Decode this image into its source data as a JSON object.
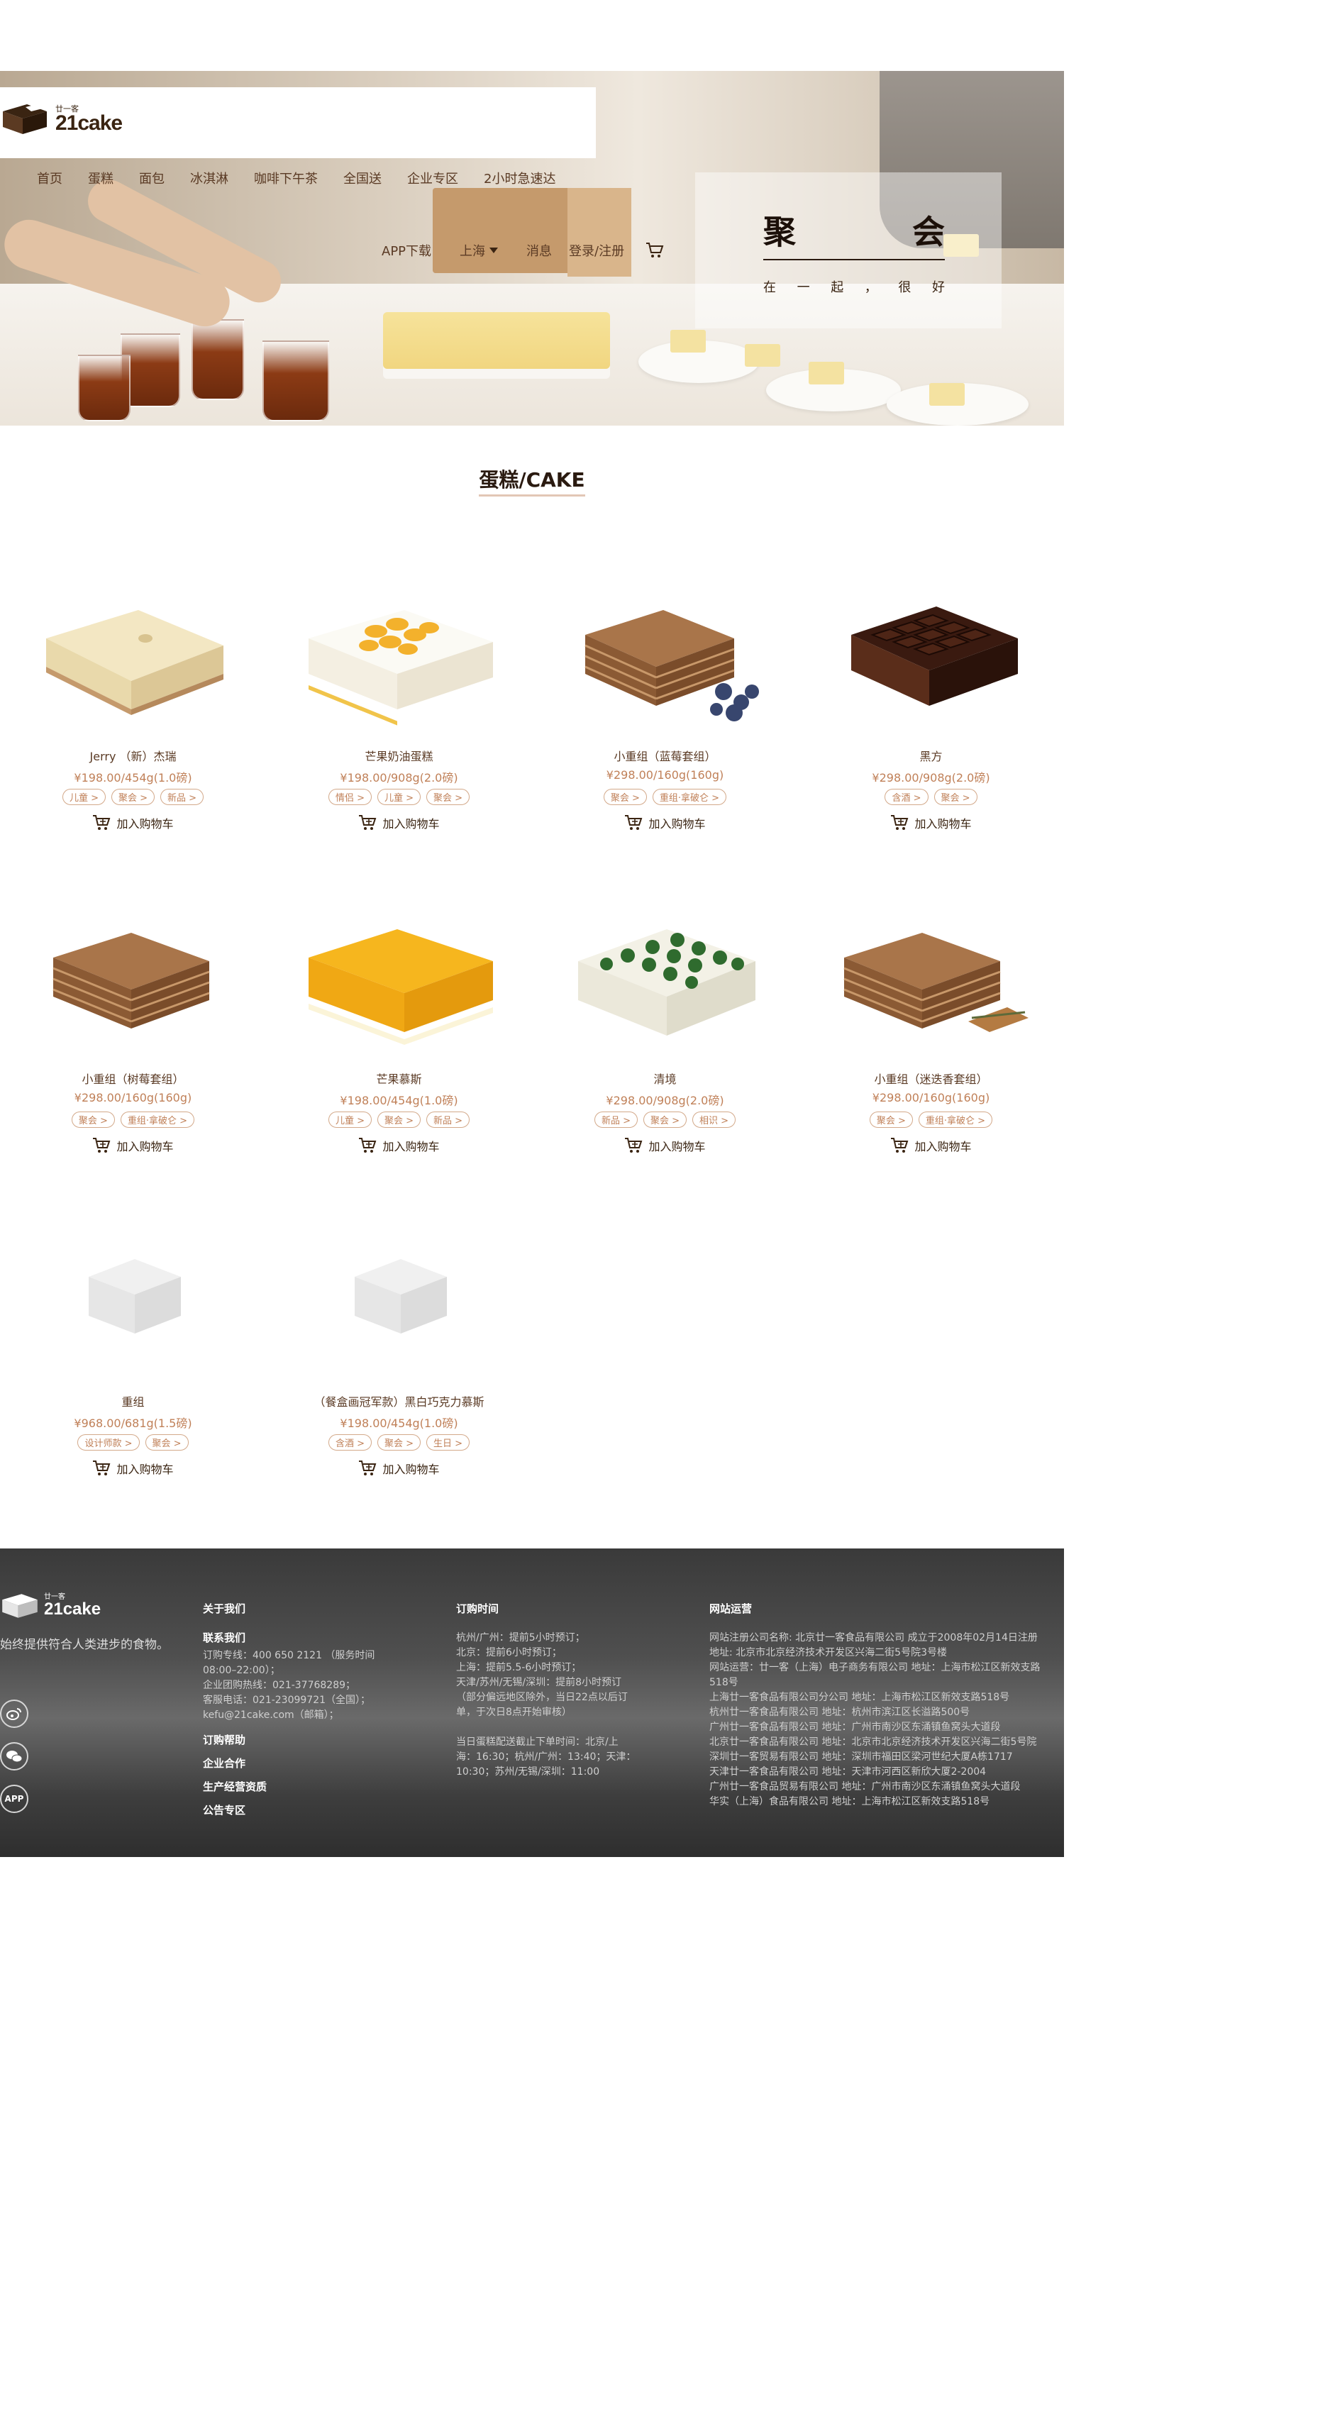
{
  "header": {
    "logo_small": "廿一客",
    "logo_big": "21cake",
    "nav": [
      "首页",
      "蛋糕",
      "面包",
      "冰淇淋",
      "咖啡下午茶",
      "全国送",
      "企业专区",
      "2小时急速达"
    ],
    "actions": {
      "app_download": "APP下载",
      "city": "上海",
      "messages": "消息",
      "login": "登录/注册"
    }
  },
  "hero": {
    "headline_chars": [
      "聚",
      "会"
    ],
    "tagline_chars": [
      "在",
      "一",
      "起",
      "，",
      "很",
      "好"
    ]
  },
  "section": {
    "title": "蛋糕/CAKE"
  },
  "products": [
    {
      "name": "Jerry （新）杰瑞",
      "price": "¥198.00/454g(1.0磅)",
      "tags": [
        "儿童 >",
        "聚会 >",
        "新品 >"
      ],
      "cart": "加入购物车",
      "image": "cheese-cake"
    },
    {
      "name": "芒果奶油蛋糕",
      "price": "¥198.00/908g(2.0磅)",
      "tags": [
        "情侣 >",
        "儿童 >",
        "聚会 >"
      ],
      "cart": "加入购物车",
      "image": "mango-cream-cake"
    },
    {
      "name": "小重组（蓝莓套组）",
      "price": "¥298.00/160g(160g)",
      "tags": [
        "聚会 >",
        "重组·拿破仑 >"
      ],
      "cart": "加入购物车",
      "image": "layered-blueberry"
    },
    {
      "name": "黑方",
      "price": "¥298.00/908g(2.0磅)",
      "tags": [
        "含酒 >",
        "聚会 >"
      ],
      "cart": "加入购物车",
      "image": "chocolate-square"
    },
    {
      "name": "小重组（树莓套组）",
      "price": "¥298.00/160g(160g)",
      "tags": [
        "聚会 >",
        "重组·拿破仑 >"
      ],
      "cart": "加入购物车",
      "image": "layered"
    },
    {
      "name": "芒果慕斯",
      "price": "¥198.00/454g(1.0磅)",
      "tags": [
        "儿童 >",
        "聚会 >",
        "新品 >"
      ],
      "cart": "加入购物车",
      "image": "mango-mousse"
    },
    {
      "name": "清境",
      "price": "¥298.00/908g(2.0磅)",
      "tags": [
        "新品 >",
        "聚会 >",
        "相识 >"
      ],
      "cart": "加入购物车",
      "image": "green-grid"
    },
    {
      "name": "小重组（迷迭香套组）",
      "price": "¥298.00/160g(160g)",
      "tags": [
        "聚会 >",
        "重组·拿破仑 >"
      ],
      "cart": "加入购物车",
      "image": "layered-rosemary"
    },
    {
      "name": "重组",
      "price": "¥968.00/681g(1.5磅)",
      "tags": [
        "设计师款 >",
        "聚会 >"
      ],
      "cart": "加入购物车",
      "image": "placeholder"
    },
    {
      "name": "（餐盒画冠军款）黑白巧克力慕斯",
      "price": "¥198.00/454g(1.0磅)",
      "tags": [
        "含酒 >",
        "聚会 >",
        "生日 >"
      ],
      "cart": "加入购物车",
      "image": "placeholder"
    }
  ],
  "footer": {
    "logo_small": "廿一客",
    "logo_big": "21cake",
    "slogan": "始终提供符合人类进步的食物。",
    "social": [
      "weibo-icon",
      "wechat-icon",
      "APP"
    ],
    "about": {
      "title": "关于我们",
      "contact_title": "联系我们",
      "contact_lines": [
        "订购专线：400 650 2121 （服务时间",
        "08:00–22:00）；",
        "企业团购热线：021-37768289；",
        "客服电话：021-23099721（全国）；",
        "kefu@21cake.com（邮箱）；"
      ],
      "links": [
        "订购帮助",
        "企业合作",
        "生产经营资质",
        "公告专区"
      ]
    },
    "order_time": {
      "title": "订购时间",
      "lines": [
        "杭州/广州：提前5小时预订；",
        "北京：提前6小时预订；",
        "上海：提前5.5-6小时预订；",
        "天津/苏州/无锡/深圳：提前8小时预订",
        "（部分偏远地区除外，当日22点以后订",
        "单，于次日8点开始审核）",
        "",
        "当日蛋糕配送截止下单时间：北京/上",
        "海：16:30；杭州/广州：13:40；天津：",
        "10:30；苏州/无锡/深圳：11:00"
      ]
    },
    "operations": {
      "title": "网站运营",
      "lines": [
        "网站注册公司名称: 北京廿一客食品有限公司 成立于2008年02月14日注册",
        "地址: 北京市北京经济技术开发区兴海二街5号院3号楼",
        "网站运营：廿一客（上海）电子商务有限公司 地址：上海市松江区新效支路",
        "518号",
        "上海廿一客食品有限公司分公司 地址：上海市松江区新效支路518号",
        "杭州廿一客食品有限公司 地址：杭州市滨江区长溢路500号",
        "广州廿一客食品有限公司 地址：广州市南沙区东涌镇鱼窝头大道段",
        "北京廿一客食品有限公司 地址：北京市北京经济技术开发区兴海二街5号院",
        "深圳廿一客贸易有限公司 地址：深圳市福田区梁河世纪大厦A栋1717",
        "天津廿一客食品有限公司 地址：天津市河西区新欣大厦2-2004",
        "广州廿一客食品贸易有限公司 地址：广州市南沙区东涌镇鱼窝头大道段",
        "华实（上海）食品有限公司 地址：上海市松江区新效支路518号"
      ]
    }
  }
}
